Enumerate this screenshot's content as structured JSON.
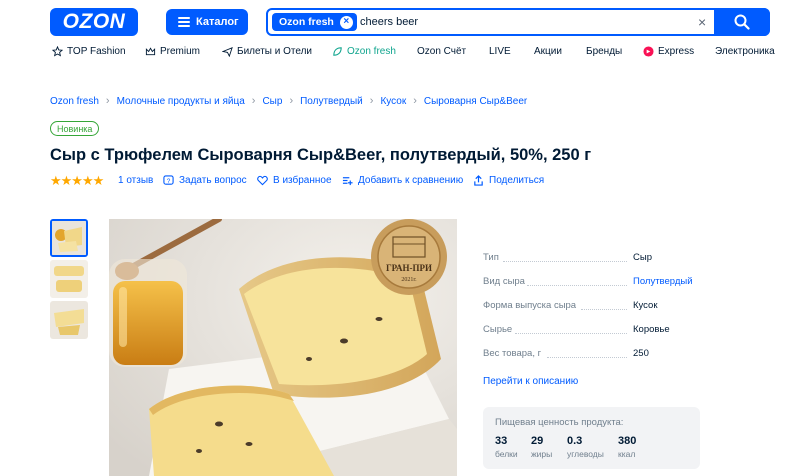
{
  "header": {
    "logo": "OZON",
    "catalog_label": "Каталог",
    "search": {
      "chip": "Ozon fresh",
      "value": "cheers beer"
    }
  },
  "nav": [
    {
      "label": "TOP Fashion",
      "icon": "star-icon"
    },
    {
      "label": "Premium",
      "icon": "crown-icon"
    },
    {
      "label": "Билеты и Отели",
      "icon": "plane-icon"
    },
    {
      "label": "Ozon fresh",
      "icon": "leaf-icon"
    },
    {
      "label": "Ozon Счёт",
      "icon": ""
    },
    {
      "label": "LIVE",
      "icon": ""
    },
    {
      "label": "Акции",
      "icon": ""
    },
    {
      "label": "Бренды",
      "icon": ""
    },
    {
      "label": "Express",
      "icon": "express-icon"
    },
    {
      "label": "Электроника",
      "icon": ""
    }
  ],
  "breadcrumbs": [
    "Ozon fresh",
    "Молочные продукты и яйца",
    "Сыр",
    "Полутвердый",
    "Кусок",
    "Сыроварня Сыр&Beer"
  ],
  "badge": "Новинка",
  "product": {
    "title": "Сыр с Трюфелем Сыроварня Сыр&Beer, полутвердый, 50%, 250 г",
    "rating_stars": 5,
    "reviews": "1 отзыв",
    "ask": "Задать вопрос",
    "favorite": "В избранное",
    "compare": "Добавить к сравнению",
    "share": "Поделиться"
  },
  "medal": {
    "text": "ГРАН-ПРИ",
    "year": "2021г."
  },
  "specs": [
    {
      "label": "Тип",
      "value": "Сыр",
      "link": false
    },
    {
      "label": "Вид сыра",
      "value": "Полутвердый",
      "link": true
    },
    {
      "label": "Форма выпуска сыра",
      "value": "Кусок",
      "link": false
    },
    {
      "label": "Сырье",
      "value": "Коровье",
      "link": false
    },
    {
      "label": "Вес товара, г",
      "value": "250",
      "link": false
    }
  ],
  "description_link": "Перейти к описанию",
  "nutrition": {
    "title": "Пищевая ценность продукта:",
    "items": [
      {
        "value": "33",
        "label": "белки"
      },
      {
        "value": "29",
        "label": "жиры"
      },
      {
        "value": "0.3",
        "label": "углеводы"
      },
      {
        "value": "380",
        "label": "ккал"
      }
    ]
  },
  "colors": {
    "brand": "#005bff",
    "fresh": "#10a58e",
    "star": "#ffa800",
    "new_badge": "#35a637"
  }
}
